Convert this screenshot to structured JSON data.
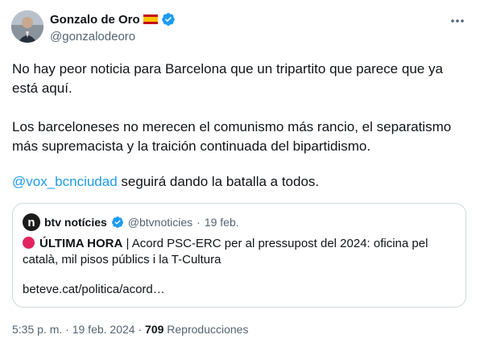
{
  "author": {
    "name": "Gonzalo de Oro",
    "handle": "@gonzalodeoro",
    "flag_icon": "spain-flag-icon",
    "verified_icon": "verified-badge-icon",
    "verified_color": "#1d9bf0"
  },
  "more_icon": "more-horizontal-icon",
  "tweet": {
    "line1": "No hay peor noticia para Barcelona que un tripartito que parece que ya",
    "line2": "está aquí.",
    "line3": "Los barceloneses no merecen el comunismo más rancio, el separatismo",
    "line4": "más supremacista y la traición continuada del bipartidismo.",
    "mention": "@vox_bcnciudad",
    "line5_rest": " seguirá dando la batalla a todos."
  },
  "quote": {
    "logo_letter": "n",
    "name": "btv notícies",
    "handle": "@btvnoticies",
    "sep": "·",
    "date": "19 feb.",
    "headline_bold": "ÚLTIMA HORA",
    "headline_rest": " | Acord PSC-ERC per al pressupost del 2024: oficina pel",
    "headline_line2": "català, mil pisos públics i la T-Cultura",
    "link": "beteve.cat/politica/acord…"
  },
  "meta": {
    "time": "5:35 p. m.",
    "sep": "·",
    "date": "19 feb. 2024",
    "sep2": "·",
    "views": "709",
    "views_label": "Reproducciones"
  },
  "colors": {
    "accent": "#1d9bf0",
    "text": "#0f1419",
    "secondary": "#536471",
    "border": "#cfd9de",
    "red": "#e0245e"
  }
}
